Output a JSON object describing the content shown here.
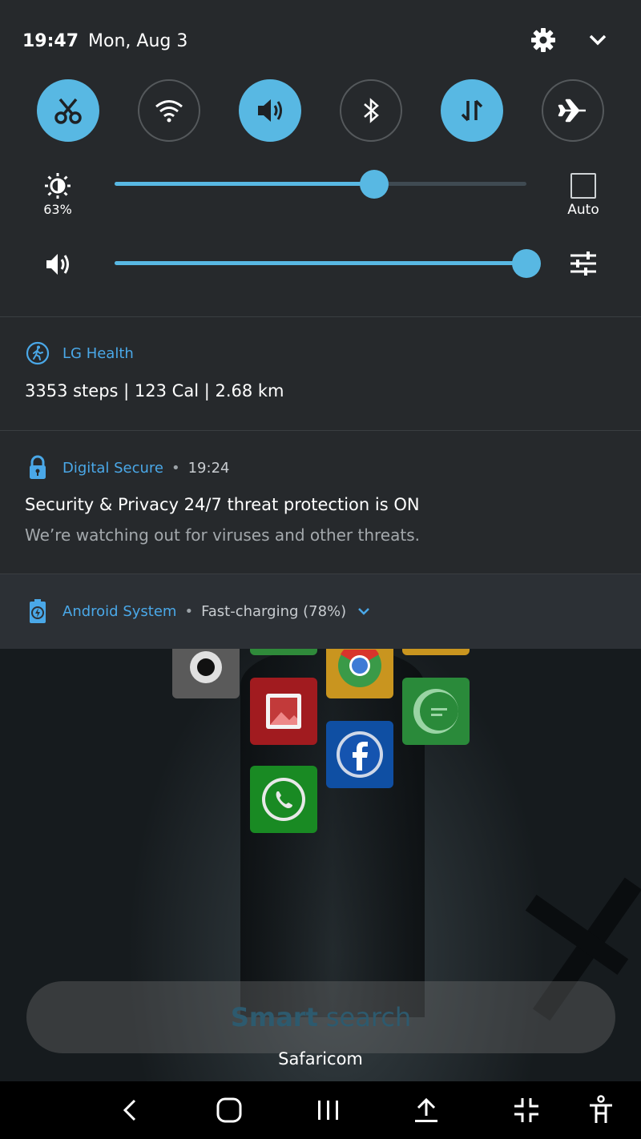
{
  "status_bar": {
    "time": "19:47",
    "date": "Mon, Aug 3"
  },
  "quick_settings": {
    "tiles": [
      {
        "name": "Screen capture",
        "icon": "scissors-icon",
        "on": true
      },
      {
        "name": "Wi-Fi",
        "icon": "wifi-icon",
        "on": false
      },
      {
        "name": "Sound",
        "icon": "volume-icon",
        "on": true
      },
      {
        "name": "Bluetooth",
        "icon": "bluetooth-icon",
        "on": false
      },
      {
        "name": "Mobile data",
        "icon": "data-transfer-icon",
        "on": true
      },
      {
        "name": "Airplane mode",
        "icon": "airplane-icon",
        "on": false
      }
    ],
    "brightness": {
      "percent_label": "63%",
      "value": 0.63,
      "auto_label": "Auto",
      "auto_checked": false
    },
    "volume": {
      "value": 1.0
    }
  },
  "notifications": [
    {
      "app": "LG Health",
      "icon": "walking-icon",
      "title": "3353 steps | 123 Cal | 2.68 km"
    },
    {
      "app": "Digital Secure",
      "icon": "lock-icon",
      "time": "19:24",
      "title": "Security & Privacy 24/7 threat protection is ON",
      "body": "We’re watching out for viruses and other threats."
    },
    {
      "app": "Android System",
      "icon": "battery-charging-icon",
      "meta": "Fast-charging (78%)"
    }
  ],
  "home": {
    "search_bold": "Smart",
    "search_light": "search",
    "carrier": "Safaricom"
  },
  "colors": {
    "accent": "#58b8e3",
    "app_name": "#4aa8e8",
    "shade_bg": "#26292c"
  }
}
